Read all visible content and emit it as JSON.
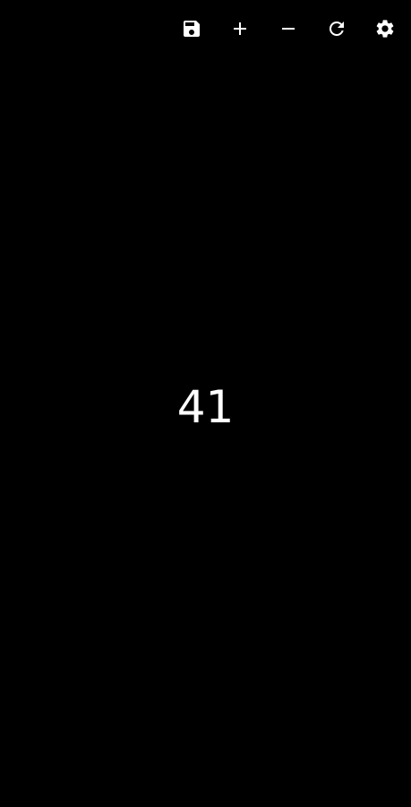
{
  "toolbar": {
    "items": [
      {
        "name": "save",
        "icon": "save-icon"
      },
      {
        "name": "increment",
        "icon": "plus-icon"
      },
      {
        "name": "decrement",
        "icon": "minus-icon"
      },
      {
        "name": "reset",
        "icon": "refresh-icon"
      },
      {
        "name": "settings",
        "icon": "gear-icon"
      }
    ]
  },
  "counter": {
    "value": "41"
  },
  "colors": {
    "background": "#000000",
    "foreground": "#ffffff"
  }
}
